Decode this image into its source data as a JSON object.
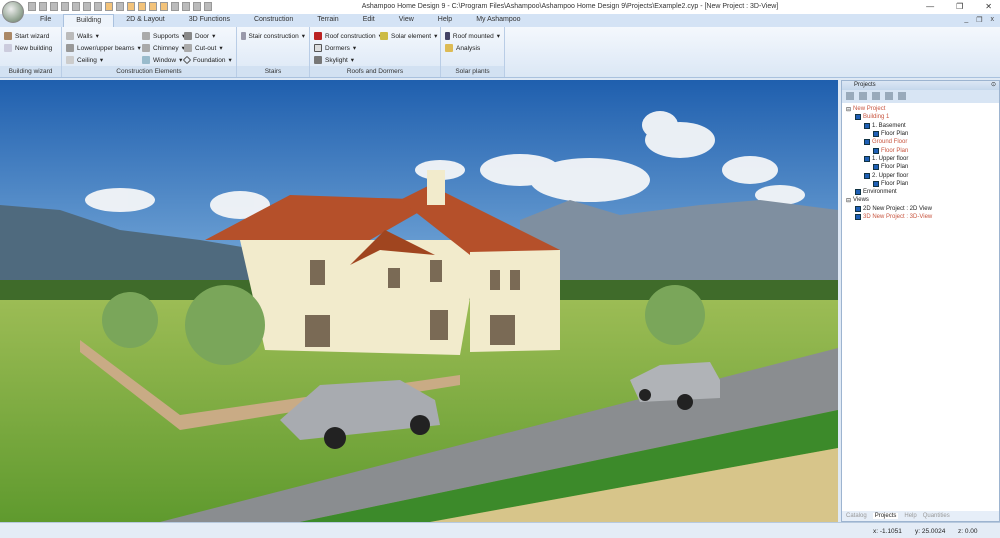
{
  "window": {
    "title": "Ashampoo Home Design 9 - C:\\Program Files\\Ashampoo\\Ashampoo Home Design 9\\Projects\\Example2.cyp - [New Project : 3D-View]",
    "minimize": "—",
    "restore": "❐",
    "close": "✕"
  },
  "tabs": [
    "File",
    "Building",
    "2D & Layout",
    "3D Functions",
    "Construction",
    "Terrain",
    "Edit",
    "View",
    "Help",
    "My Ashampoo"
  ],
  "active_tab": "Building",
  "mdi": {
    "minimize": "_",
    "restore": "❐",
    "close": "x"
  },
  "ribbon": {
    "building_wizard": {
      "label": "Building wizard",
      "items": [
        "Start wizard",
        "New building"
      ]
    },
    "construction": {
      "label": "Construction Elements",
      "items": [
        "Walls",
        "Lower/upper beams",
        "Ceiling",
        "Supports",
        "Chimney",
        "Window",
        "Door",
        "Cut-out",
        "Foundation"
      ]
    },
    "stairs": {
      "label": "Stairs",
      "items": [
        "Stair construction"
      ]
    },
    "roofs": {
      "label": "Roofs and Dormers",
      "items": [
        "Roof construction",
        "Dormers",
        "Skylight",
        "Solar element"
      ]
    },
    "solar": {
      "label": "Solar plants",
      "items": [
        "Roof mounted",
        "Analysis"
      ]
    }
  },
  "panel": {
    "title": "Projects",
    "tree": [
      {
        "label": "New Project",
        "level": 0,
        "cb": false,
        "red": true
      },
      {
        "label": "Building 1",
        "level": 1,
        "cb": true,
        "red": true
      },
      {
        "label": "1. Basement",
        "level": 2,
        "cb": true,
        "red": false
      },
      {
        "label": "Floor Plan",
        "level": 3,
        "cb": true,
        "red": false
      },
      {
        "label": "Ground Floor",
        "level": 2,
        "cb": true,
        "red": true
      },
      {
        "label": "Floor Plan",
        "level": 3,
        "cb": true,
        "red": true
      },
      {
        "label": "1. Upper floor",
        "level": 2,
        "cb": true,
        "red": false
      },
      {
        "label": "Floor Plan",
        "level": 3,
        "cb": true,
        "red": false
      },
      {
        "label": "2. Upper floor",
        "level": 2,
        "cb": true,
        "red": false
      },
      {
        "label": "Floor Plan",
        "level": 3,
        "cb": true,
        "red": false
      },
      {
        "label": "Environment",
        "level": 1,
        "cb": true,
        "red": false
      },
      {
        "label": "Views",
        "level": 0,
        "cb": false,
        "red": false
      },
      {
        "label": "2D  New Project : 2D View",
        "level": 1,
        "cb": true,
        "red": false
      },
      {
        "label": "3D  New Project : 3D-View",
        "level": 1,
        "cb": true,
        "red": true
      }
    ],
    "tabs": [
      "Catalog",
      "Projects",
      "Help",
      "Quantities"
    ],
    "active": "Projects"
  },
  "status": {
    "x": "x: -1.1051",
    "y": "y: 25.0024",
    "z": "z: 0.00"
  }
}
